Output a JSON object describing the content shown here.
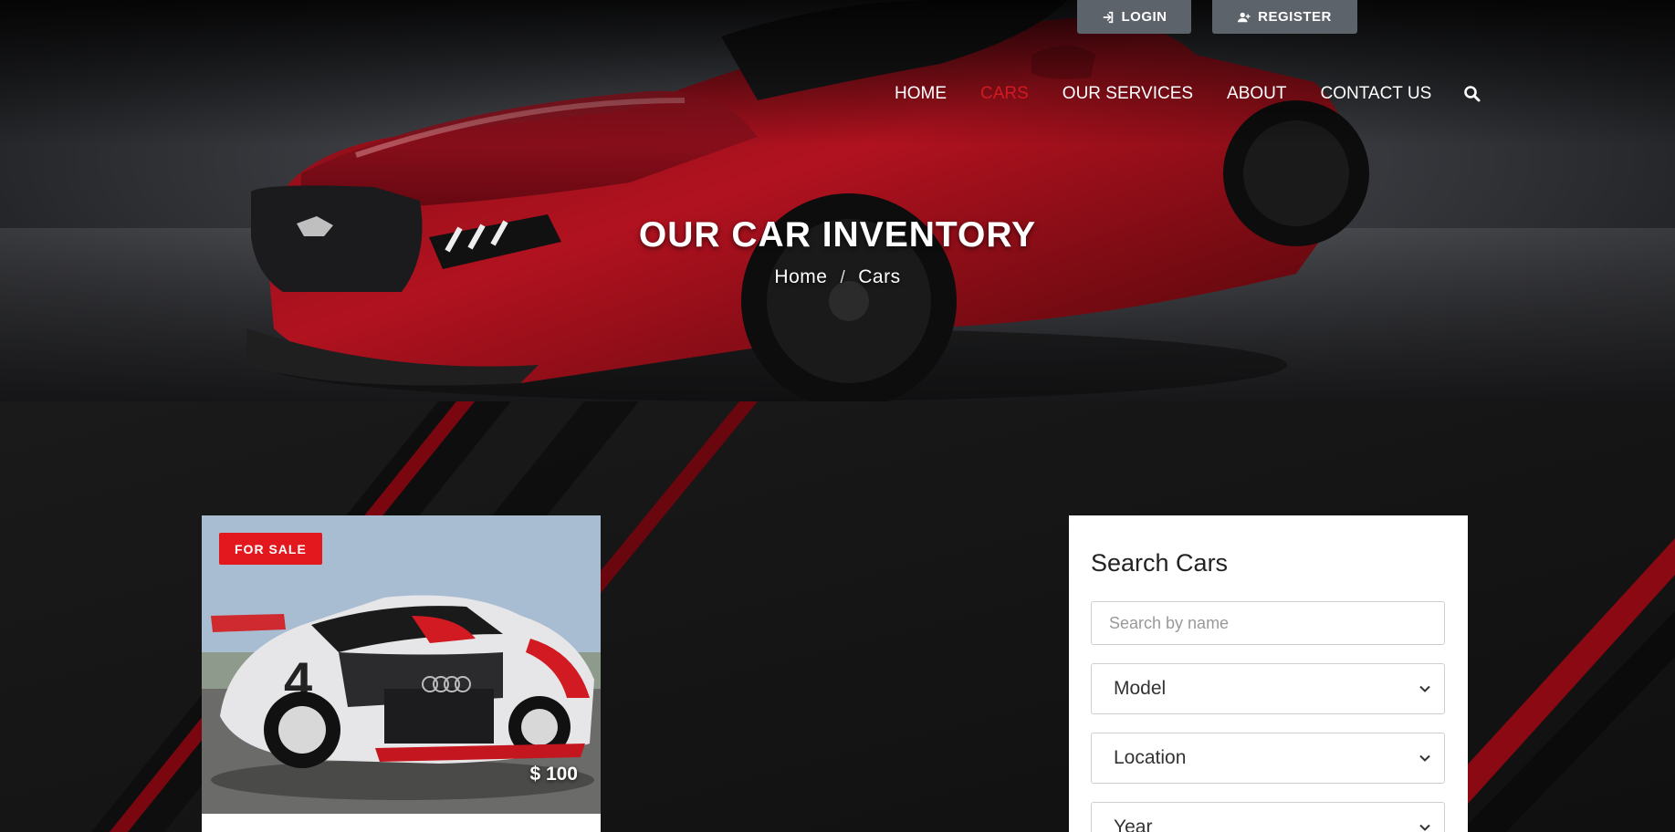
{
  "auth": {
    "login_label": "LOGIN",
    "register_label": "REGISTER"
  },
  "nav": {
    "items": [
      {
        "label": "HOME",
        "active": false
      },
      {
        "label": "CARS",
        "active": true
      },
      {
        "label": "OUR SERVICES",
        "active": false
      },
      {
        "label": "ABOUT",
        "active": false
      },
      {
        "label": "CONTACT US",
        "active": false
      }
    ],
    "search_icon": "search-icon"
  },
  "hero": {
    "title": "OUR CAR INVENTORY",
    "breadcrumb": {
      "home": "Home",
      "separator": "/",
      "current": "Cars"
    }
  },
  "listing": {
    "badge": "FOR SALE",
    "price": "$ 100"
  },
  "search": {
    "title": "Search Cars",
    "name_placeholder": "Search by name",
    "model": "Model",
    "location": "Location",
    "year": "Year"
  },
  "colors": {
    "accent": "#d11a22",
    "badge": "#e3181f",
    "auth_button": "#5d636b",
    "body_bg": "#161616"
  }
}
